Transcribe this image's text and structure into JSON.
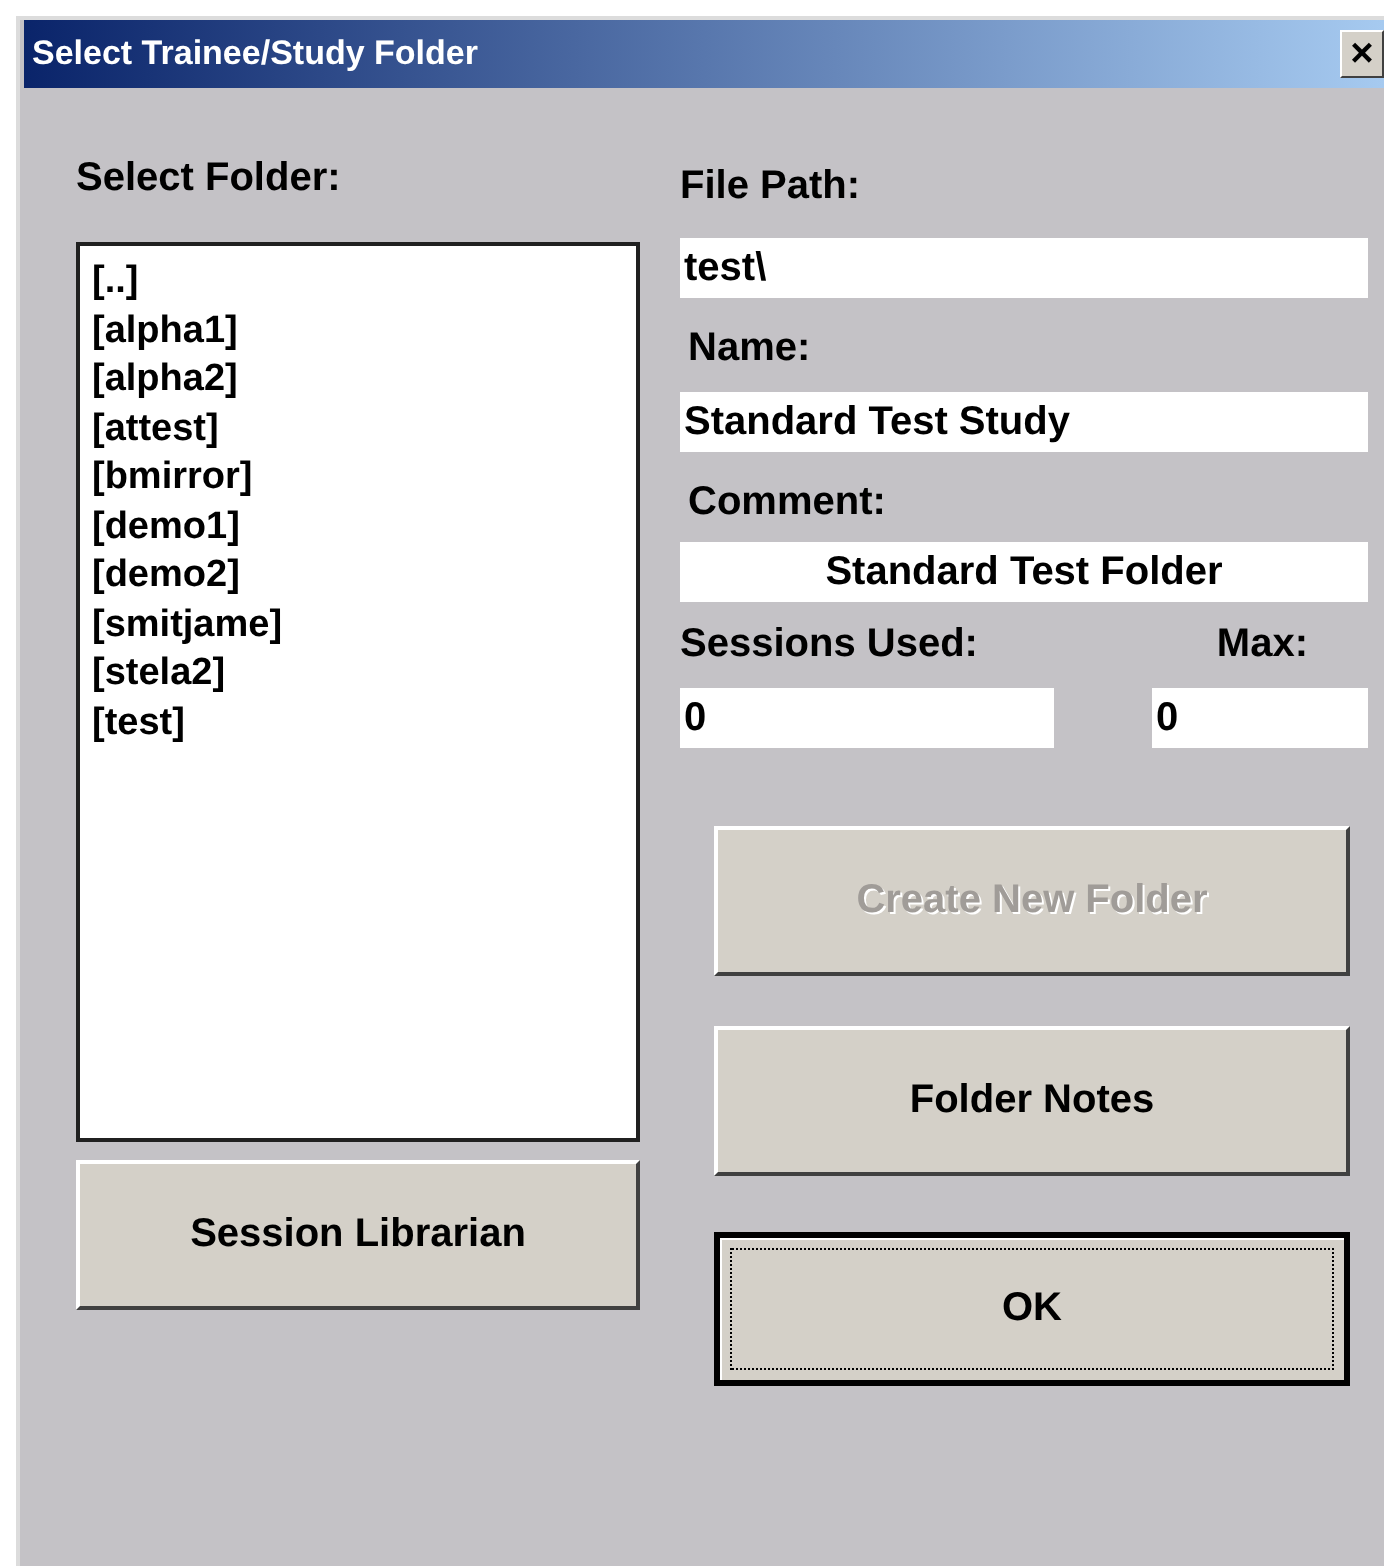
{
  "window": {
    "title": "Select Trainee/Study Folder",
    "close": "×"
  },
  "folder_list": {
    "label": "Select Folder:",
    "items": [
      {
        "text": "[..]",
        "selected": false
      },
      {
        "text": "[alpha1]",
        "selected": false
      },
      {
        "text": "[alpha2]",
        "selected": false
      },
      {
        "text": "[attest]",
        "selected": false
      },
      {
        "text": "[bmirror]",
        "selected": false
      },
      {
        "text": "[demo1]",
        "selected": false
      },
      {
        "text": "[demo2]",
        "selected": false
      },
      {
        "text": "[smitjame]",
        "selected": false
      },
      {
        "text": "[stela2]",
        "selected": false
      },
      {
        "text": "[test]",
        "selected": false
      }
    ]
  },
  "file_path": {
    "label": "File Path:",
    "value": "test\\"
  },
  "name": {
    "label": "Name:",
    "value": "Standard Test Study"
  },
  "comment": {
    "label": "Comment:",
    "value": "Standard Test Folder",
    "centered": true
  },
  "sessions_used": {
    "label": "Sessions Used:",
    "value": "0"
  },
  "max": {
    "label": "Max:",
    "value": "0"
  },
  "buttons": [
    {
      "label": "Create New Folder",
      "disabled": true,
      "default": false
    },
    {
      "label": "Session Librarian",
      "disabled": false,
      "default": false
    },
    {
      "label": "Folder Notes",
      "disabled": false,
      "default": false
    },
    {
      "label": "OK",
      "disabled": false,
      "default": true
    }
  ]
}
